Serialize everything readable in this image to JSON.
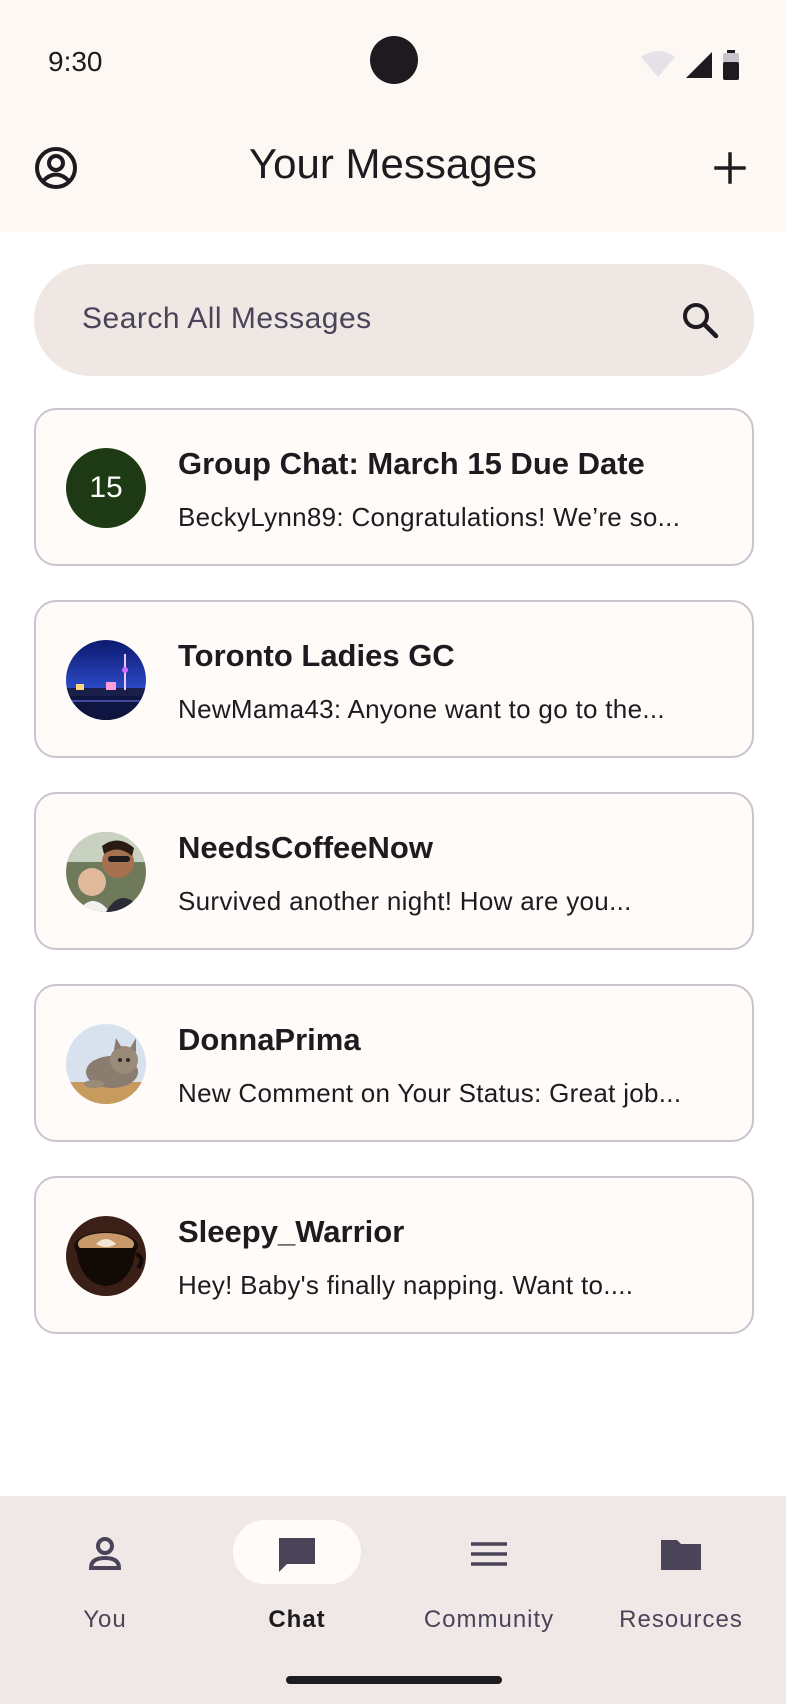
{
  "status_bar": {
    "time": "9:30"
  },
  "app_bar": {
    "title": "Your Messages"
  },
  "search": {
    "placeholder": "Search All Messages"
  },
  "conversations": [
    {
      "title": "Group Chat: March 15 Due Date",
      "preview": "BeckyLynn89: Congratulations! We’re so...",
      "avatar_text": "15",
      "avatar_color": "#1e3a14"
    },
    {
      "title": "Toronto Ladies GC",
      "preview": "NewMama43: Anyone want to go to the...",
      "avatar": "toronto-skyline-photo"
    },
    {
      "title": "NeedsCoffeeNow",
      "preview": "Survived another night! How are you...",
      "avatar": "mom-and-baby-photo"
    },
    {
      "title": "DonnaPrima",
      "preview": "New Comment on Your Status: Great job...",
      "avatar": "cat-photo"
    },
    {
      "title": "Sleepy_Warrior",
      "preview": "Hey! Baby's finally napping. Want to....",
      "avatar": "coffee-cup-photo"
    }
  ],
  "bottom_nav": {
    "items": [
      {
        "label": "You",
        "icon": "person-icon"
      },
      {
        "label": "Chat",
        "icon": "chat-bubble-icon",
        "active": true
      },
      {
        "label": "Community",
        "icon": "menu-lines-icon"
      },
      {
        "label": "Resources",
        "icon": "folder-icon"
      }
    ]
  },
  "colors": {
    "surface": "#fdf8f3",
    "accent_dark_green": "#1e3a14",
    "nav_background": "#f0e8e6"
  }
}
